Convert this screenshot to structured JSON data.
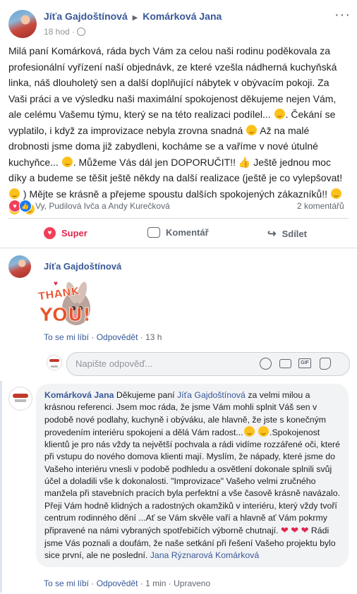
{
  "post": {
    "author": "Jíťa Gajdoštínová",
    "recipient": "Komárková Jana",
    "time": "18 hod",
    "text": "Milá paní Komárková, ráda bych Vám za celou naši rodinu poděkovala za profesionální vyřízení naší objednávk, ze které vzešla nádherná kuchyňská linka, náš dlouholetý sen a další doplňující nábytek v obývacím pokoji. Za Vaši práci a ve výsledku naši maximální spokojenost děkujeme nejen Vám, ale celému Vašemu týmu, který se na této realizaci podílel...",
    "text2": ". Čekání se vyplatilo, i když za improvizace nebyla zrovna snadná",
    "text3": "Až na malé drobnosti jsme doma již zabydleni, kocháme se a vaříme v nové útulné kuchyňce...",
    "text4": ". Můžeme Vás dál jen DOPORUČIT!!",
    "text5": "Ještě jednou moc díky a budeme se těšit ještě někdy na další realizace (ještě je co vylepšovat!",
    "text6": ") Mějte se krásně a přejeme spoustu dalších spokojených zákazníků!!"
  },
  "reactions": {
    "summary": "Vy, Pudilová Ivča a Andy Kurečková",
    "comments_count": "2 komentářů"
  },
  "actions": {
    "like": "Super",
    "comment": "Komentář",
    "share": "Sdílet"
  },
  "comment1": {
    "author": "Jíťa Gajdoštínová",
    "sticker": "THANK YOU!",
    "like": "To se mi líbí",
    "reply": "Odpovědět",
    "time": "13 h"
  },
  "reply_box": {
    "placeholder": "Napište odpověď..."
  },
  "comment2": {
    "author": "Komárková Jana",
    "intro": "Děkujeme paní",
    "mention": "Jíťa Gajdoštínová",
    "text1": "za velmi milou a krásnou referenci. Jsem moc ráda, že jsme Vám mohli splnit Váš sen v podobě nové podlahy, kuchyně i obýváku, ale hlavně, že jste s konečným provedením interiéru spokojeni a dělá Vám radost...",
    "text2": ".Spokojenost klientů je pro nás vždy ta největší pochvala a rádi vidíme rozzářené oči, které při vstupu do nového domova klienti mají. Myslím, že nápady, které jsme do Vašeho interiéru vnesli v podobě podhledu a osvětlení dokonale splnili svůj účel a doladili vše k dokonalosti. \"Improvizace\" Vašeho velmi zručného manžela při stavebních pracích byla perfektní a vše časově krásně navázalo. Přeji Vám hodně klidných a radostných okamžiků v interiéru, který vždy tvoří centrum rodinného dění ...Ať se Vám skvěle vaří a hlavně ať Vám pokrmy připravené na námi vybraných spotřebičích výborně chutnají.",
    "text3": "Rádi jsme Vás poznali a doufám, že naše setkání při řešení Vašeho projektu bylo sice první, ale ne poslední.",
    "signature": "Jana Rýznarová Komárková",
    "like": "To se mi líbí",
    "reply": "Odpovědět",
    "time": "1 min",
    "edited": "Upraveno"
  },
  "colors": {
    "link": "#385898",
    "like_red": "#e2264d",
    "meta": "#90949c"
  }
}
